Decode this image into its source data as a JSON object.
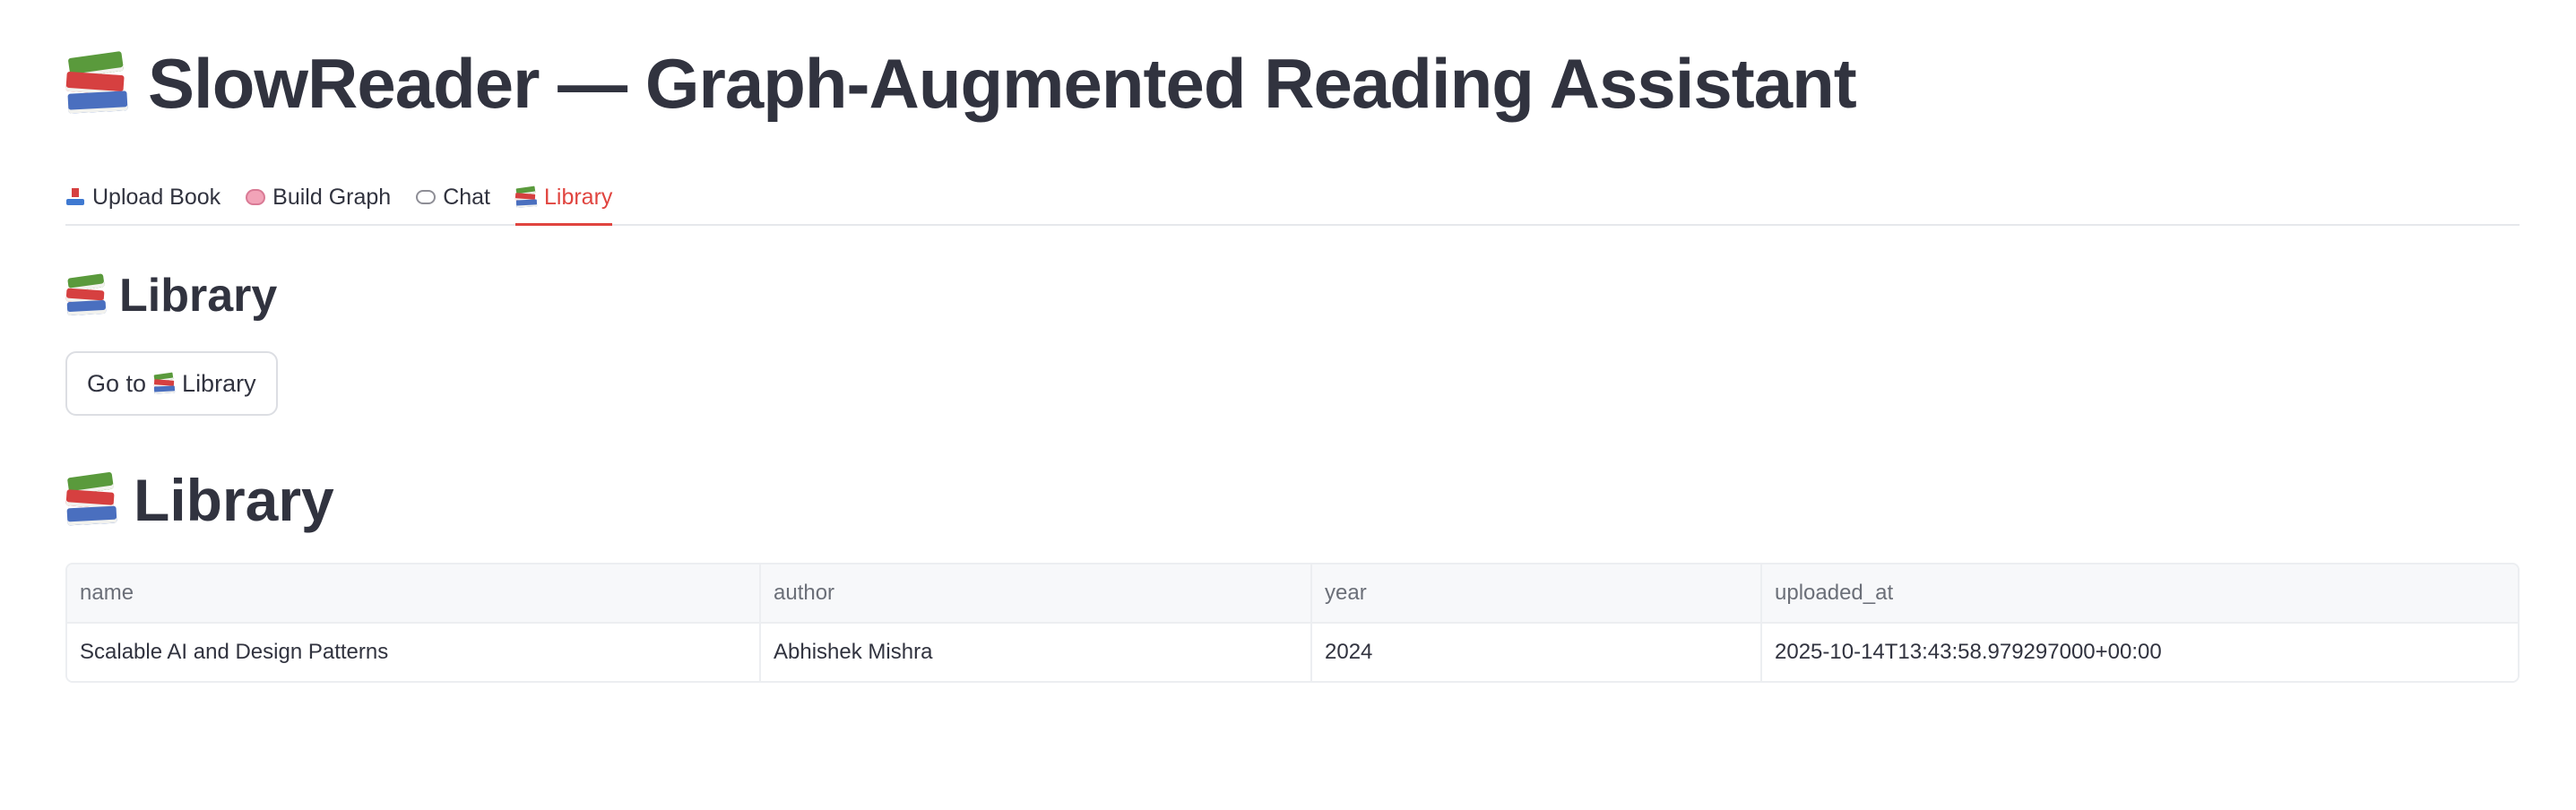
{
  "app": {
    "title": "SlowReader — Graph-Augmented Reading Assistant"
  },
  "tabs": [
    {
      "label": "Upload Book",
      "icon": "inbox-tray-icon",
      "active": false
    },
    {
      "label": "Build Graph",
      "icon": "brain-icon",
      "active": false
    },
    {
      "label": "Chat",
      "icon": "speech-bubble-icon",
      "active": false
    },
    {
      "label": "Library",
      "icon": "books-icon",
      "active": true
    }
  ],
  "library": {
    "heading": "Library",
    "nav_button_prefix": "Go to",
    "nav_button_label": "Library",
    "table_heading": "Library",
    "table": {
      "columns": [
        "name",
        "author",
        "year",
        "uploaded_at"
      ],
      "rows": [
        [
          "Scalable AI and Design Patterns",
          "Abhishek Mishra",
          "2024",
          "2025-10-14T13:43:58.979297000+00:00"
        ]
      ]
    }
  },
  "colors": {
    "accent": "#e0443f",
    "text": "#31333f",
    "muted": "#6b6f78",
    "border": "#eceef1"
  }
}
